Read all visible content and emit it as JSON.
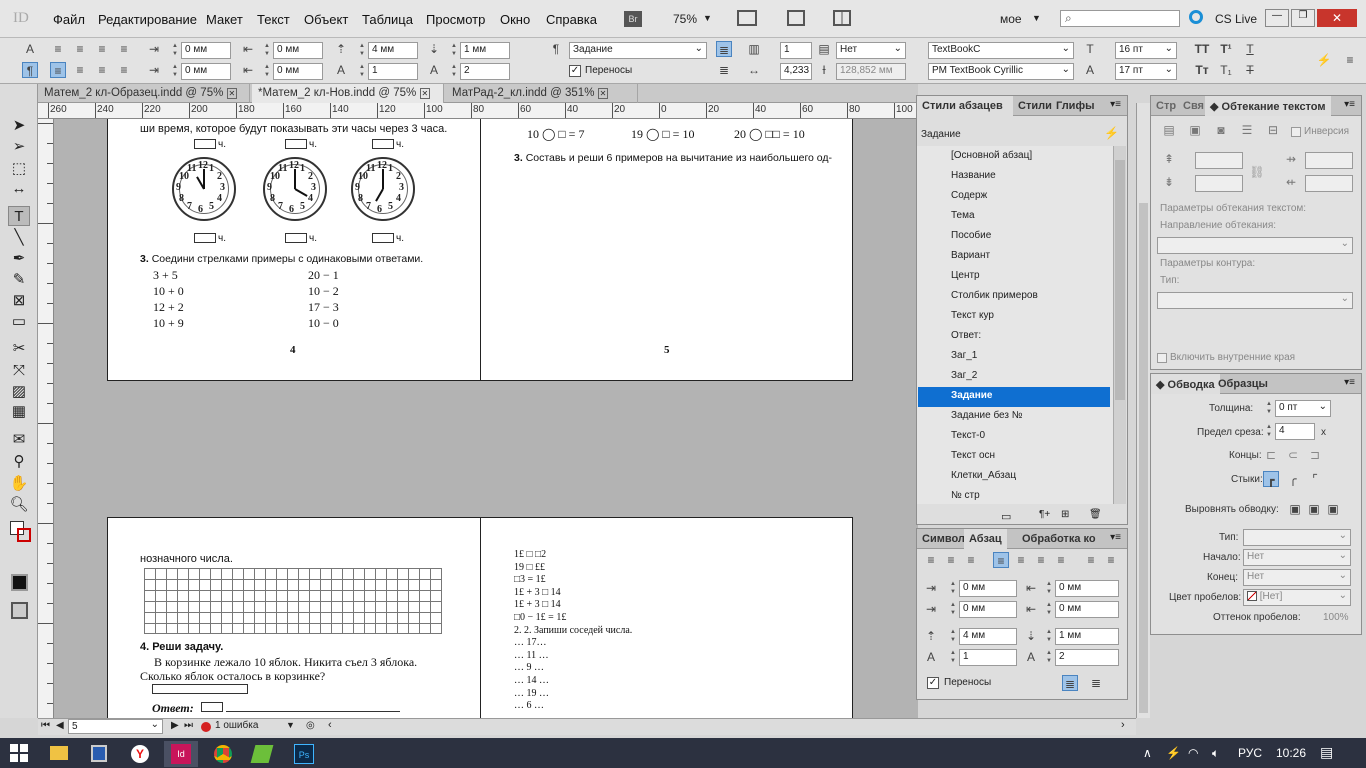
{
  "app": {
    "logo": "ID",
    "workspace": "мое",
    "cs_live": "CS Live",
    "zoom": "75%",
    "bridge": "Br"
  },
  "menu": [
    "Файл",
    "Редактирование",
    "Макет",
    "Текст",
    "Объект",
    "Таблица",
    "Просмотр",
    "Окно",
    "Справка"
  ],
  "control": {
    "indent_left": "0 мм",
    "indent_right": "0 мм",
    "first_line": "0 мм",
    "last_line": "0 мм",
    "space_before": "4 мм",
    "space_after": "1 мм",
    "drop_lines": "1",
    "drop_chars": "2",
    "style": "Задание",
    "hyphenation_label": "Переносы",
    "columns": "1",
    "none": "Нет",
    "col_width": "4,233",
    "gutter": "128,852 мм",
    "font": "TextBookC",
    "font_style": "PM TextBook Cyrillic",
    "size": "16 пт",
    "leading": "17 пт"
  },
  "tabs": [
    "Матем_2 кл-Образец.indd @ 75%",
    "*Матем_2 кл-Нов.indd @ 75%",
    "МатРад-2_кл.indd @ 351%"
  ],
  "ruler_labels": [
    "260",
    "240",
    "220",
    "200",
    "180",
    "160",
    "140",
    "120",
    "100",
    "80",
    "60",
    "40",
    "20",
    "0",
    "20",
    "40",
    "60",
    "80",
    "100"
  ],
  "pages": {
    "p4": {
      "line1": "ши время, которое будут показывать эти часы через 3 часа.",
      "hours": "ч.",
      "task3": "Соедини стрелками примеры с одинаковыми ответами.",
      "left_exprs": [
        "3 + 5",
        "10 + 0",
        "12 + 2",
        "10 + 9"
      ],
      "right_exprs": [
        "20 − 1",
        "10 − 2",
        "17 − 3",
        "10 − 0"
      ],
      "page_num": "4",
      "clock_digits": [
        "12",
        "1",
        "2",
        "3",
        "4",
        "5",
        "6",
        "7",
        "8",
        "9",
        "10",
        "11"
      ]
    },
    "p5": {
      "eq1": "10 ◯ □ = 7",
      "eq2": "19 ◯ □ = 10",
      "eq3": "20 ◯ □□ = 10",
      "task3": "Составь и реши 6 примеров на вычитание из наибольшего од-",
      "page_num": "5"
    },
    "p6": {
      "line1": "нозначного числа.",
      "task4": "4. Реши задачу.",
      "problem1": "В корзинке лежало 10 яблок. Никита съел 3 яблока.",
      "problem2": "Сколько яблок осталось в корзинке?",
      "answer": "Ответ:"
    },
    "p7": {
      "lines": [
        "1£ □ □2",
        "19 □ ££",
        "□3 = 1£",
        "1£ + 3 □ 14",
        "1£ + 3 □ 14",
        "□0 − 1£ = 1£",
        "2.       2. Запиши соседей числа.",
        "… 17…",
        "… 11 …",
        "… 9 …",
        "… 14 …",
        "… 19 …",
        "… 6 …"
      ]
    }
  },
  "styles_panel": {
    "tabs": [
      "Стили абзацев",
      "Стили",
      "Глифы"
    ],
    "current": "Задание",
    "items": [
      "[Основной абзац]",
      "Название",
      "Содерж",
      "Тема",
      "Пособие",
      "Вариант",
      "Центр",
      "Столбик примеров",
      "Текст кур",
      "Ответ:",
      "Заг_1",
      "Заг_2",
      "Задание",
      "Задание без №",
      "Текст-0",
      "Текст осн",
      "Клетки_Абзац",
      "№ стр"
    ],
    "selected_index": 12
  },
  "para_panel": {
    "tabs": [
      "Символ",
      "Абзац",
      "Обработка ко"
    ],
    "indent_left": "0 мм",
    "indent_right": "0 мм",
    "first": "0 мм",
    "last": "0 мм",
    "before": "4 мм",
    "after": "1 мм",
    "drop_lines": "1",
    "drop_chars": "2",
    "hyphen": "Переносы"
  },
  "wrap_panel": {
    "tabs": [
      "Стр",
      "Свя",
      "Обтекание текстом"
    ],
    "invert": "Инверсия",
    "options": "Параметры обтекания текстом:",
    "direction": "Направление обтекания:",
    "contour": "Параметры контура:",
    "type": "Тип:",
    "inner": "Включить внутренние края"
  },
  "stroke_panel": {
    "tabs": [
      "Обводка",
      "Образцы"
    ],
    "weight_label": "Толщина:",
    "weight": "0 пт",
    "miter_label": "Предел среза:",
    "miter": "4",
    "miter_x": "x",
    "cap_label": "Концы:",
    "join_label": "Стыки:",
    "align_label": "Выровнять обводку:",
    "type_label": "Тип:",
    "start_label": "Начало:",
    "start": "Нет",
    "end_label": "Конец:",
    "end": "Нет",
    "gap_label": "Цвет пробелов:",
    "gap": "[Нет]",
    "tint_label": "Оттенок пробелов:",
    "tint": "100%"
  },
  "status": {
    "page": "5",
    "errors": "1 ошибка"
  },
  "taskbar": {
    "lang": "РУС",
    "time": "10:26"
  },
  "colors": {
    "accent": "#0f6fd1",
    "taskbar": "#2c3140",
    "indesign": "#c8155a"
  }
}
